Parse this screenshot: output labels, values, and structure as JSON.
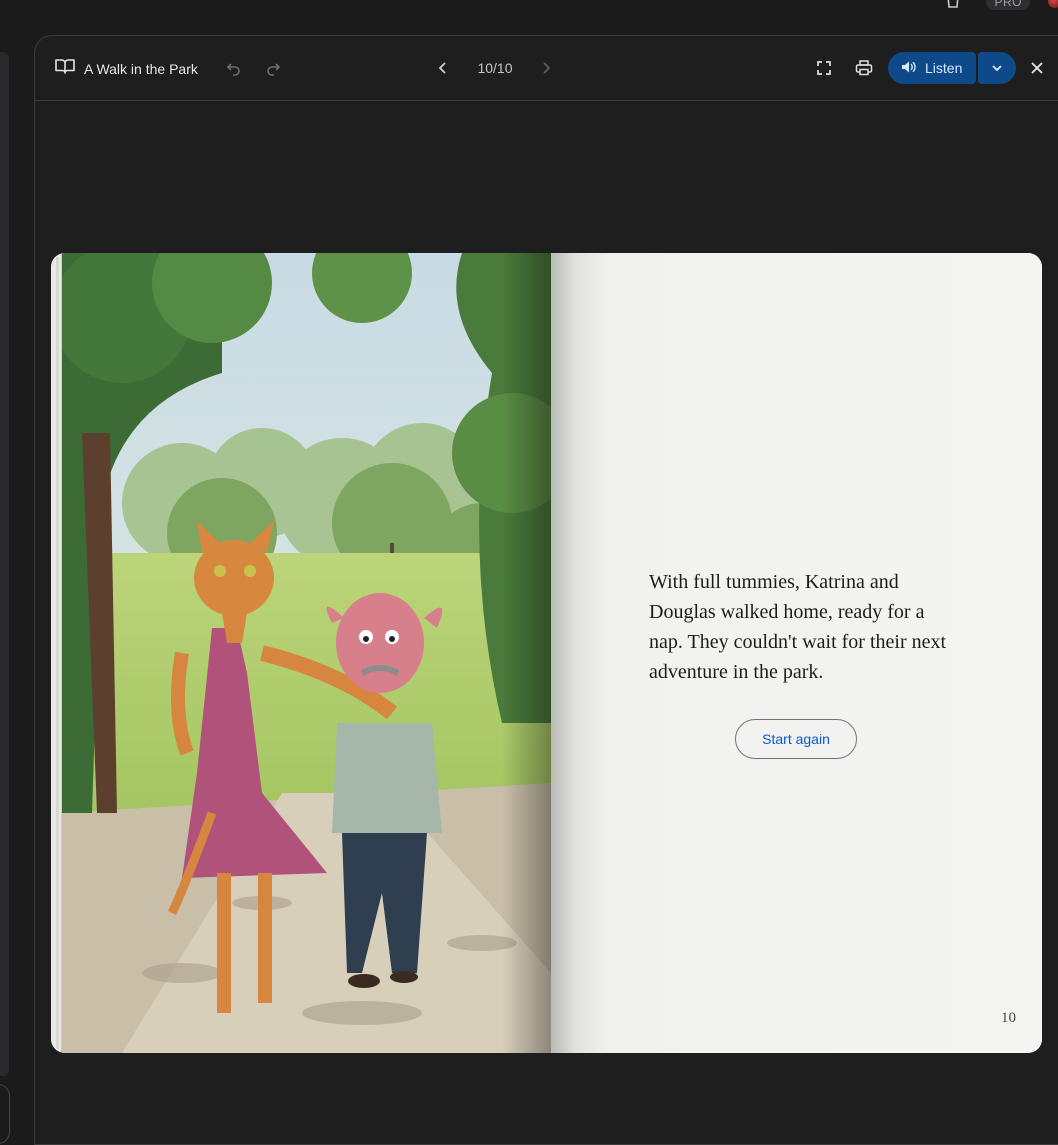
{
  "toolbar": {
    "title": "A Walk in the Park",
    "page_indicator": "10/10",
    "listen_label": "Listen"
  },
  "top_bar": {
    "badge": "PRO"
  },
  "book": {
    "story_text": "With full tummies, Katrina and Douglas walked home, ready for a nap. They couldn't wait for their next adventure in the park.",
    "start_again_label": "Start again",
    "page_number": "10"
  },
  "colors": {
    "background": "#1b1b1c",
    "listen_button": "#0e4a8a",
    "start_again_text": "#0b57d0",
    "page_paper": "#f4f4f2"
  },
  "icons": [
    "book-open-icon",
    "undo-icon",
    "redo-icon",
    "chevron-left-icon",
    "chevron-right-icon",
    "fullscreen-icon",
    "print-icon",
    "speaker-icon",
    "chevron-down-icon",
    "close-icon",
    "trash-icon"
  ]
}
